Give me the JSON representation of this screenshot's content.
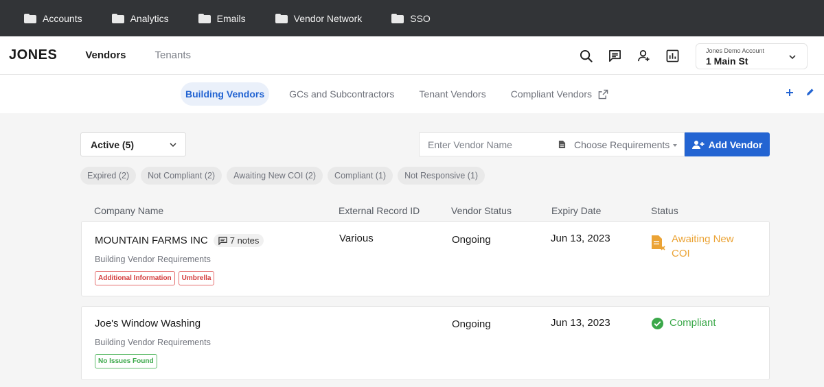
{
  "topbar": {
    "items": [
      {
        "label": "Accounts"
      },
      {
        "label": "Analytics"
      },
      {
        "label": "Emails"
      },
      {
        "label": "Vendor Network"
      },
      {
        "label": "SSO"
      }
    ]
  },
  "header": {
    "logo": "JONES",
    "nav": [
      {
        "label": "Vendors"
      },
      {
        "label": "Tenants"
      }
    ],
    "icons": [
      "search-icon",
      "chat-icon",
      "user-add-icon",
      "report-icon"
    ],
    "account": {
      "sub": "Jones Demo Account",
      "main": "1 Main St"
    }
  },
  "subnav": {
    "tabs": [
      {
        "label": "Building Vendors",
        "active": true
      },
      {
        "label": "GCs and Subcontractors"
      },
      {
        "label": "Tenant Vendors"
      },
      {
        "label": "Compliant Vendors"
      }
    ]
  },
  "controls": {
    "filter_value": "Active (5)",
    "search_placeholder": "Enter Vendor Name",
    "requirements_placeholder": "Choose Requirements",
    "add_label": "Add Vendor"
  },
  "chips": [
    {
      "label": "Expired (2)"
    },
    {
      "label": "Not Compliant (2)"
    },
    {
      "label": "Awaiting New COI (2)"
    },
    {
      "label": "Compliant (1)"
    },
    {
      "label": "Not Responsive (1)"
    }
  ],
  "table": {
    "headers": [
      "Company Name",
      "External Record ID",
      "Vendor Status",
      "Expiry Date",
      "Status"
    ],
    "rows": [
      {
        "company": "MOUNTAIN FARMS INC",
        "notes": "7 notes",
        "requirements": "Building Vendor Requirements",
        "tags": [
          "Additional Information",
          "Umbrella"
        ],
        "external_id": "Various",
        "vendor_status": "Ongoing",
        "expiry": "Jun 13, 2023",
        "status": "Awaiting New COI"
      },
      {
        "company": "Joe's Window Washing",
        "requirements": "Building Vendor Requirements",
        "tags": [
          "No Issues Found"
        ],
        "external_id": "",
        "vendor_status": "Ongoing",
        "expiry": "Jun 13, 2023",
        "status": "Compliant"
      }
    ]
  },
  "colors": {
    "accent": "#2364d2",
    "topbar": "#323437",
    "awaiting": "#eba335",
    "compliant": "#3ba84a",
    "tag_red": "#d33b3b"
  }
}
